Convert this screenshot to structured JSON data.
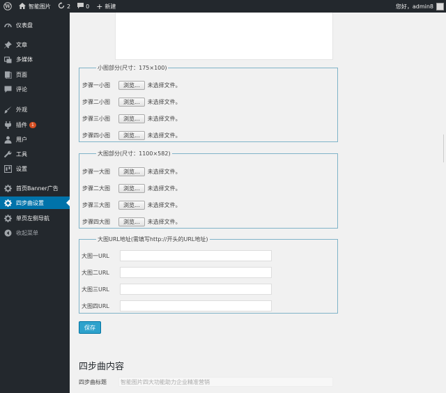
{
  "adminbar": {
    "site_name": "智能图片",
    "updates_count": "2",
    "comments_count": "0",
    "new_label": "新建",
    "greeting": "您好，admin8"
  },
  "sidebar": {
    "items": [
      {
        "label": "仪表盘",
        "icon": "dashboard-icon"
      },
      {
        "label": "文章",
        "icon": "pin-icon"
      },
      {
        "label": "多媒体",
        "icon": "media-icon"
      },
      {
        "label": "页面",
        "icon": "page-icon"
      },
      {
        "label": "评论",
        "icon": "comment-icon"
      },
      {
        "label": "外观",
        "icon": "brush-icon"
      },
      {
        "label": "插件",
        "icon": "plugin-icon",
        "badge": "1"
      },
      {
        "label": "用户",
        "icon": "user-icon"
      },
      {
        "label": "工具",
        "icon": "wrench-icon"
      },
      {
        "label": "设置",
        "icon": "settings-icon"
      },
      {
        "label": "首页Banner广告",
        "icon": "gear-icon"
      },
      {
        "label": "四步曲设置",
        "icon": "gear-icon",
        "active": true
      },
      {
        "label": "单页左侧导航",
        "icon": "gear-icon"
      },
      {
        "label": "收起菜单",
        "icon": "collapse-icon"
      }
    ]
  },
  "small_images": {
    "legend": "小图部分(尺寸：175×100)",
    "rows": [
      {
        "label": "步骤一小图",
        "button": "浏览...",
        "status": "未选择文件。"
      },
      {
        "label": "步骤二小图",
        "button": "浏览...",
        "status": "未选择文件。"
      },
      {
        "label": "步骤三小图",
        "button": "浏览...",
        "status": "未选择文件。"
      },
      {
        "label": "步骤四小图",
        "button": "浏览...",
        "status": "未选择文件。"
      }
    ]
  },
  "large_images": {
    "legend": "大图部分(尺寸：1100×582)",
    "rows": [
      {
        "label": "步骤一大图",
        "button": "浏览...",
        "status": "未选择文件。"
      },
      {
        "label": "步骤二大图",
        "button": "浏览...",
        "status": "未选择文件。"
      },
      {
        "label": "步骤三大图",
        "button": "浏览...",
        "status": "未选择文件。"
      },
      {
        "label": "步骤四大图",
        "button": "浏览...",
        "status": "未选择文件。"
      }
    ]
  },
  "urls": {
    "legend": "大图URL地址(需填写http://开头的URL地址)",
    "rows": [
      {
        "label": "大图一URL",
        "value": ""
      },
      {
        "label": "大图二URL",
        "value": ""
      },
      {
        "label": "大图三URL",
        "value": ""
      },
      {
        "label": "大图四URL",
        "value": ""
      }
    ]
  },
  "save_label": "保存",
  "content_section": {
    "title": "四步曲内容",
    "step_title_label": "四步曲标题",
    "step_title_value": "智能图片四大功能助力企业精准营销"
  },
  "colors": {
    "admin_bg": "#23282d",
    "active_blue": "#0073aa",
    "button_blue": "#2ea2cc",
    "fieldset_border": "#7fb3c8",
    "badge_orange": "#d54e21"
  }
}
